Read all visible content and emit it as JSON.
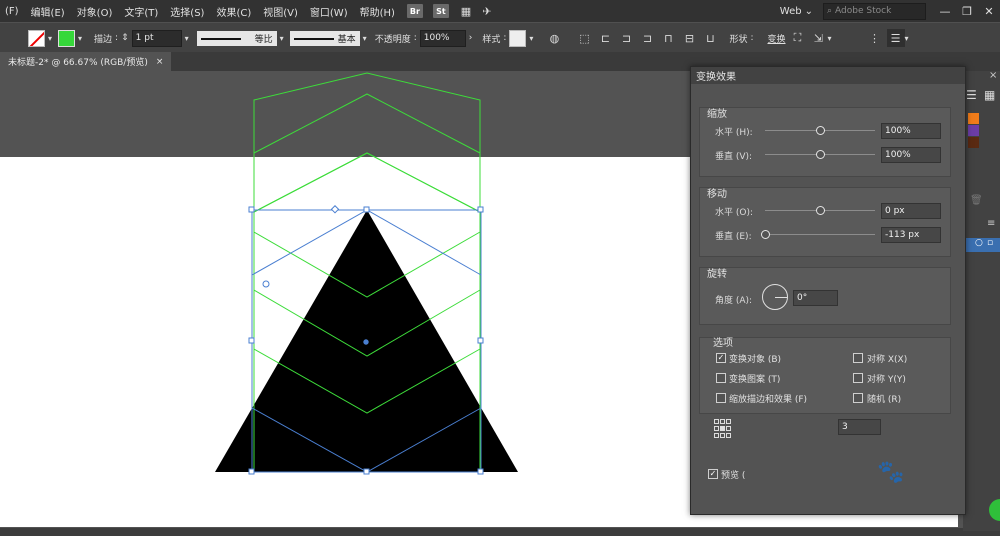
{
  "menubar": {
    "items": [
      "(F)",
      "编辑(E)",
      "对象(O)",
      "文字(T)",
      "选择(S)",
      "效果(C)",
      "视图(V)",
      "窗口(W)",
      "帮助(H)"
    ],
    "badges": [
      "Br",
      "St"
    ],
    "workspace": "Web",
    "search_placeholder": "Adobe Stock",
    "window_buttons": [
      "—",
      "❐",
      "✕"
    ]
  },
  "controlbar": {
    "stroke_label": "描边",
    "stroke_weight": "1 pt",
    "profile_label": "等比",
    "brush_label": "基本",
    "opacity_label": "不透明度",
    "opacity_value": "100%",
    "style_label": "样式",
    "shape_label": "形状",
    "transform_label": "变换"
  },
  "document": {
    "tab_title": "未标题-2* @ 66.67% (RGB/预览)",
    "close_glyph": "×"
  },
  "dialog": {
    "title": "变换效果",
    "scale": {
      "title": "缩放",
      "horizontal_label": "水平 (H):",
      "horizontal_value": "100%",
      "horizontal_slider": 0.5,
      "vertical_label": "垂直 (V):",
      "vertical_value": "100%",
      "vertical_slider": 0.5
    },
    "move": {
      "title": "移动",
      "horizontal_label": "水平 (O):",
      "horizontal_value": "0 px",
      "horizontal_slider": 0.5,
      "vertical_label": "垂直 (E):",
      "vertical_value": "-113 px",
      "vertical_slider": 0.0
    },
    "rotate": {
      "title": "旋转",
      "angle_label": "角度 (A):",
      "angle_value": "0°"
    },
    "options": {
      "title": "选项",
      "transform_objects": "变换对象 (B)",
      "transform_objects_checked": true,
      "transform_patterns": "变换图案 (T)",
      "transform_patterns_checked": false,
      "scale_strokes": "缩放描边和效果 (F)",
      "scale_strokes_checked": false,
      "reflect_x": "对称 X(X)",
      "reflect_x_checked": false,
      "reflect_y": "对称 Y(Y)",
      "reflect_y_checked": false,
      "random": "随机 (R)",
      "random_checked": false
    },
    "copies_value": "3",
    "preview_label": "预览 (",
    "preview_checked": true
  },
  "colors": {
    "triangle_fill": "#000000",
    "green_stroke": "#3ddc3a",
    "selection_blue": "#4a7fd1",
    "dock_orange": "#f07c1a",
    "dock_purple": "#6b3da6",
    "dock_brown": "#5a2a12"
  }
}
